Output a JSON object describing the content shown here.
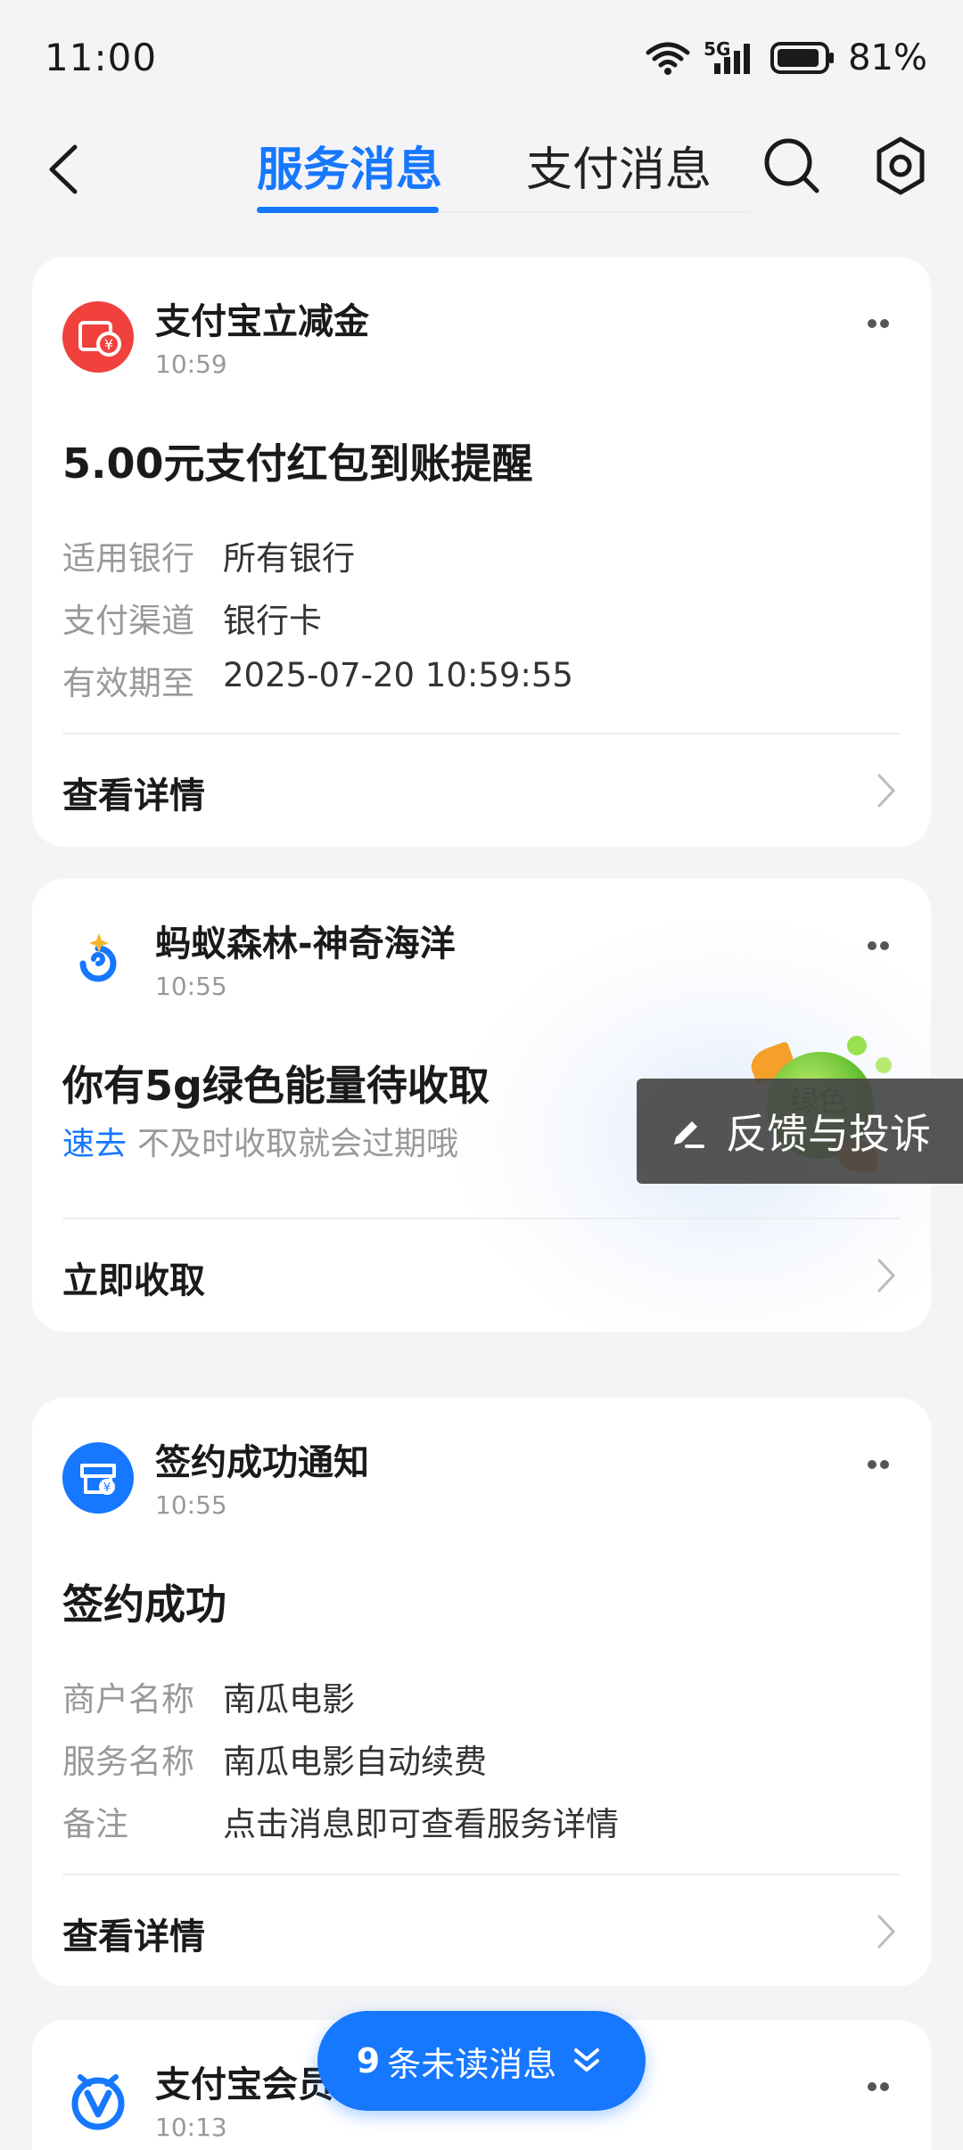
{
  "status_bar": {
    "time": "11:00",
    "network": "5G",
    "battery": "81%"
  },
  "header": {
    "tabs": [
      {
        "label": "服务消息",
        "active": true
      },
      {
        "label": "支付消息",
        "active": false
      }
    ]
  },
  "cards": [
    {
      "app_name": "支付宝立减金",
      "time": "10:59",
      "title": "5.00元支付红包到账提醒",
      "rows": [
        {
          "key": "适用银行",
          "value": "所有银行"
        },
        {
          "key": "支付渠道",
          "value": "银行卡"
        },
        {
          "key": "有效期至",
          "value": "2025-07-20 10:59:55"
        }
      ],
      "action": "查看详情"
    },
    {
      "app_name": "蚂蚁森林-神奇海洋",
      "time": "10:55",
      "title": "你有5g绿色能量待收取",
      "highlight": "速去",
      "subtitle": "不及时收取就会过期哦",
      "energy_label": "绿色",
      "action": "立即收取"
    },
    {
      "app_name": "签约成功通知",
      "time": "10:55",
      "title": "签约成功",
      "rows": [
        {
          "key": "商户名称",
          "value": "南瓜电影"
        },
        {
          "key": "服务名称",
          "value": "南瓜电影自动续费"
        },
        {
          "key": "备注",
          "value": "点击消息即可查看服务详情"
        }
      ],
      "action": "查看详情"
    },
    {
      "app_name": "支付宝会员",
      "time": "10:13"
    }
  ],
  "feedback": {
    "label": "反馈与投诉"
  },
  "unread": {
    "count": "9",
    "label": "条未读消息"
  },
  "colors": {
    "accent": "#1677ff",
    "background": "#f4f4f6",
    "red_icon": "#f0413d"
  }
}
